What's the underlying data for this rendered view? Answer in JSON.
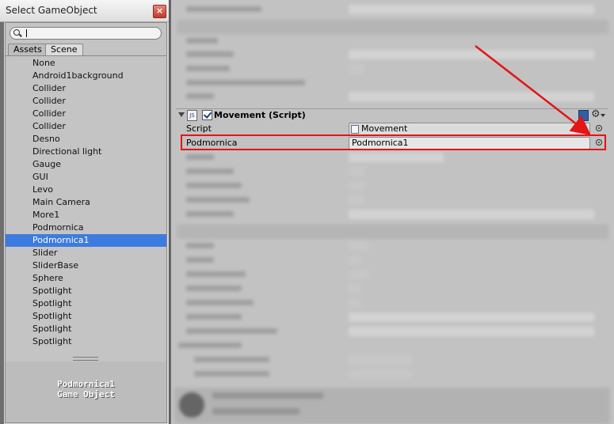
{
  "picker_window": {
    "title": "Select GameObject",
    "close_label": "×",
    "search_value": "",
    "tabs": [
      "Assets",
      "Scene"
    ],
    "active_tab": "Scene",
    "items": [
      "None",
      "Android1background",
      "Collider",
      "Collider",
      "Collider",
      "Collider",
      "Desno",
      "Directional light",
      "Gauge",
      "GUI",
      "Levo",
      "Main Camera",
      "More1",
      "Podmornica",
      "Podmornica1",
      "Slider",
      "SliderBase",
      "Sphere",
      "Spotlight",
      "Spotlight",
      "Spotlight",
      "Spotlight",
      "Spotlight"
    ],
    "selected_item": "Podmornica1",
    "preview": {
      "name": "Podmornica1",
      "type": "Game Object"
    }
  },
  "inspector": {
    "component": {
      "icon": "JS",
      "enabled": true,
      "title": "Movement (Script)"
    },
    "properties": [
      {
        "label": "Script",
        "value": "Movement"
      },
      {
        "label": "Podmornica",
        "value": "Podmornica1"
      }
    ]
  },
  "colors": {
    "selection": "#3d7be0",
    "highlight": "#e31515"
  },
  "icons": {
    "search": "search-icon",
    "close": "close-icon",
    "gear": "gear-icon",
    "help": "help-book-icon",
    "object_picker": "object-picker-icon",
    "script": "script-icon"
  }
}
